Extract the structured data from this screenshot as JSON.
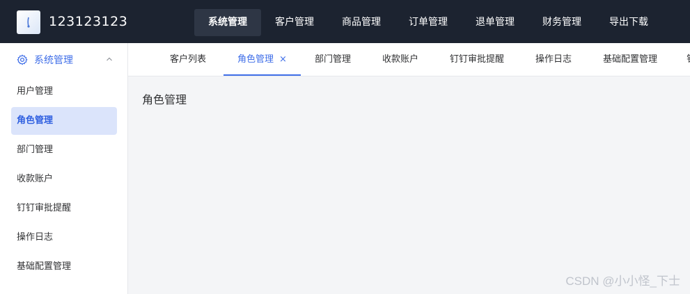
{
  "header": {
    "app_title": "123123123",
    "nav": [
      {
        "label": "系统管理",
        "active": true
      },
      {
        "label": "客户管理"
      },
      {
        "label": "商品管理"
      },
      {
        "label": "订单管理"
      },
      {
        "label": "退单管理"
      },
      {
        "label": "财务管理"
      },
      {
        "label": "导出下载"
      }
    ]
  },
  "sidebar": {
    "group": {
      "label": "系统管理",
      "icon": "gear-icon",
      "expand_icon": "chevron-up-icon"
    },
    "items": [
      {
        "label": "用户管理"
      },
      {
        "label": "角色管理",
        "active": true
      },
      {
        "label": "部门管理"
      },
      {
        "label": "收款账户"
      },
      {
        "label": "钉钉审批提醒"
      },
      {
        "label": "操作日志"
      },
      {
        "label": "基础配置管理"
      }
    ]
  },
  "tabs": [
    {
      "label": "客户列表"
    },
    {
      "label": "角色管理",
      "active": true,
      "close": "×"
    },
    {
      "label": "部门管理"
    },
    {
      "label": "收款账户"
    },
    {
      "label": "钉钉审批提醒"
    },
    {
      "label": "操作日志"
    },
    {
      "label": "基础配置管理"
    },
    {
      "label": "钅"
    }
  ],
  "content": {
    "title": "角色管理"
  },
  "watermark": "CSDN @小小怪_下士",
  "colors": {
    "header_bg": "#1c2330",
    "accent": "#3f6ee8",
    "active_bg": "#dbe4fb",
    "content_bg": "#f4f5f7"
  }
}
